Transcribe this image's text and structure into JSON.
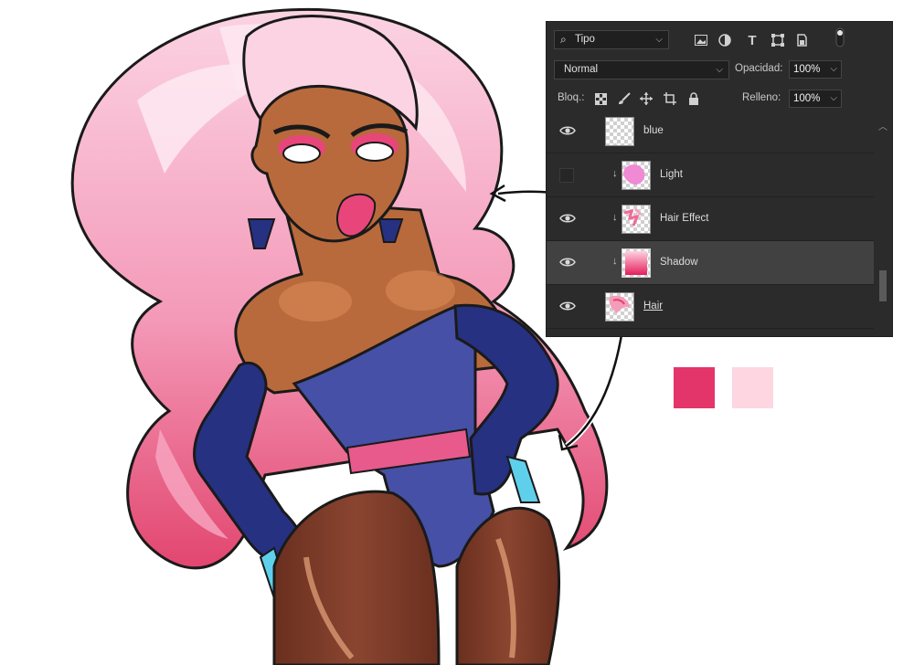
{
  "layers_panel": {
    "filter_kind": "Tipo",
    "blend_mode": "Normal",
    "opacity_label": "Opacidad:",
    "opacity_value": "100%",
    "lock_label": "Bloq.:",
    "fill_label": "Relleno:",
    "fill_value": "100%",
    "layers": [
      {
        "name": "blue",
        "visible": true,
        "clipped": false,
        "thumb": "transparent",
        "selected": false
      },
      {
        "name": "Light",
        "visible": false,
        "clipped": true,
        "thumb": "pink-blob",
        "selected": false
      },
      {
        "name": "Hair Effect",
        "visible": true,
        "clipped": true,
        "thumb": "pink-texture",
        "selected": false
      },
      {
        "name": "Shadow",
        "visible": true,
        "clipped": true,
        "thumb": "pink-gradient",
        "selected": true
      },
      {
        "name": "Hair",
        "visible": true,
        "clipped": false,
        "thumb": "hair",
        "selected": false
      }
    ]
  },
  "swatches": [
    {
      "color": "#e4356a"
    },
    {
      "color": "#fdd6e2"
    }
  ],
  "colors": {
    "hair_light": "#f9c6d8",
    "hair_mid": "#f27aa5",
    "hair_dark": "#e0456f",
    "skin": "#b86a3c",
    "suit": "#4550a6",
    "glove": "#273182",
    "belt": "#e85a8c",
    "tights": "#6e3222",
    "ring": "#5fd0ec"
  }
}
